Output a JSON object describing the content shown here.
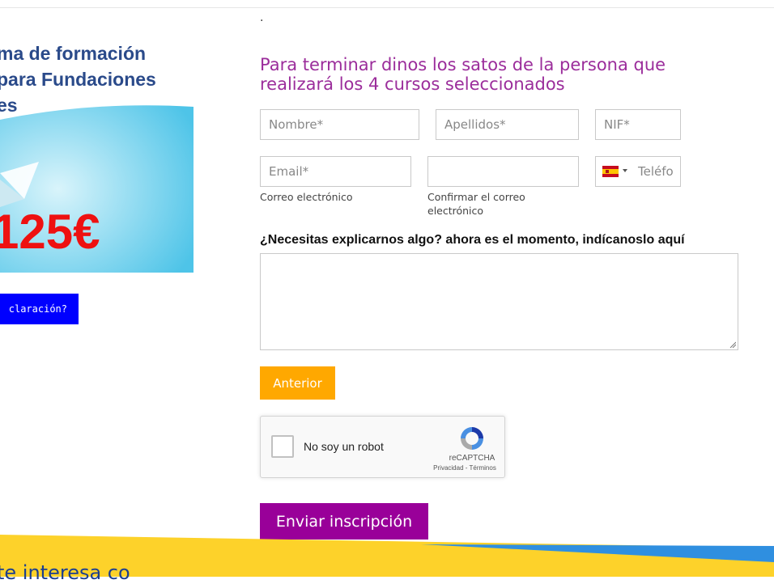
{
  "header": {
    "dot": "."
  },
  "banner": {
    "heading_line1": "ma de formación",
    "heading_line2": "para Fundaciones",
    "heading_line3": "es",
    "price": "125€",
    "ask_button": "claración?"
  },
  "form": {
    "title": "Para terminar dinos los satos de la persona que realizará los 4 cursos seleccionados",
    "fields": {
      "nombre_placeholder": "Nombre*",
      "apellidos_placeholder": "Apellidos*",
      "nif_placeholder": "NIF*",
      "email_placeholder": "Email*",
      "email_confirm_value": "",
      "telefono_placeholder": "Teléfo"
    },
    "help": {
      "email": "Correo electrónico",
      "email_confirm": "Confirmar el correo electrónico"
    },
    "question": "¿Necesitas explicarnos algo? ahora es el momento, indícanoslo aquí",
    "previous_button": "Anterior",
    "recaptcha": {
      "label": "No soy un robot",
      "brand": "reCAPTCHA",
      "links": "Privacidad - Términos"
    },
    "submit_button": "Enviar inscripción"
  },
  "footer": {
    "text": "te interesa co"
  },
  "colors": {
    "title": "#9b2d9b",
    "submit": "#990099",
    "previous": "#ffa800",
    "ask_button": "#0000ff",
    "price": "#ee1111",
    "footer_yellow": "#fdd22a",
    "footer_blue": "#2f8fe0"
  }
}
